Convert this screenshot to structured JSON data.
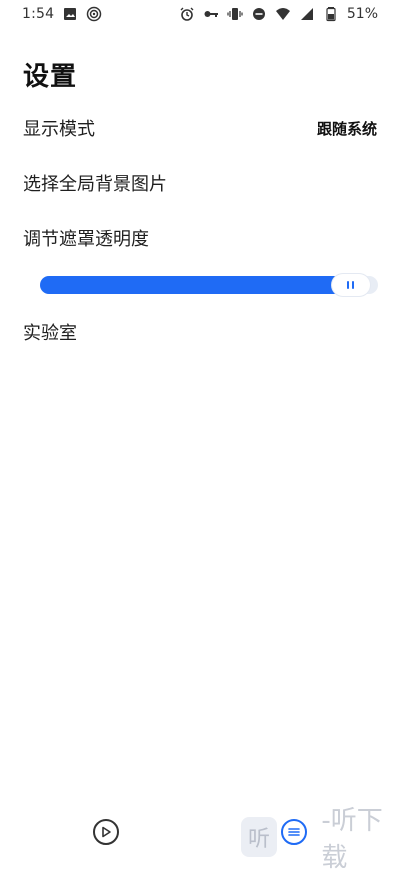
{
  "status_bar": {
    "time": "1:54",
    "battery_percent_text": "51%",
    "icons_left": [
      "image-icon",
      "broadcast-icon"
    ],
    "icons_right": [
      "alarm-icon",
      "key-icon",
      "vibrate-icon",
      "dnd-icon",
      "wifi-icon",
      "signal-icon",
      "battery-icon"
    ]
  },
  "page": {
    "title": "设置"
  },
  "settings": {
    "display_mode": {
      "label": "显示模式",
      "value": "跟随系统"
    },
    "background_image": {
      "label": "选择全局背景图片"
    },
    "mask_opacity": {
      "label": "调节遮罩透明度",
      "slider_value_fraction": 0.92
    },
    "lab": {
      "label": "实验室"
    }
  },
  "bottom": {
    "icons": [
      "play-icon",
      "menu-icon"
    ],
    "watermark_text": "-听下载",
    "watermark_logo": "听"
  },
  "colors": {
    "accent": "#1f6bf5",
    "text": "#1a1a1a",
    "background": "#ffffff"
  }
}
